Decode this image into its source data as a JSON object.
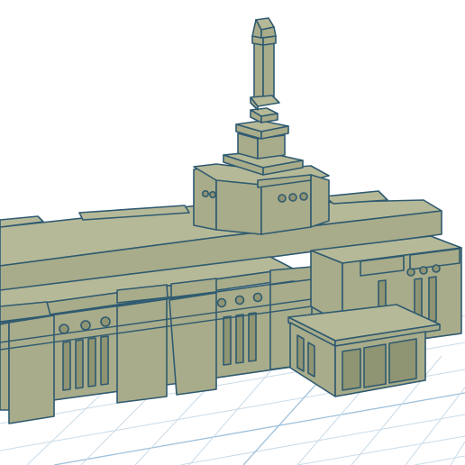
{
  "viewport": {
    "background": "#ffffff",
    "workplane_grid_color": "#c9dbe8",
    "model_color": "#a8ac8a",
    "edge_color": "#2f5a70"
  },
  "scene": {
    "object": "temple-model"
  }
}
